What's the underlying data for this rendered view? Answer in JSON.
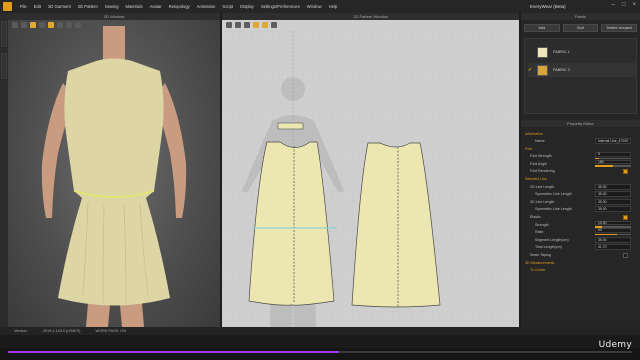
{
  "titlebar": {
    "menu": [
      "File",
      "Edit",
      "3D Garment",
      "2D Pattern",
      "Sewing",
      "Materials",
      "Avatar",
      "Retopology",
      "Animation",
      "Script",
      "Display",
      "Settings/Preferences",
      "Window",
      "Help"
    ],
    "app_title": "EveryWear (Beta)"
  },
  "panels": {
    "win3d_title": "3D Window",
    "win2d_title": "2D Pattern Window",
    "fabric_title": "Fabric",
    "property_title": "Property Editor"
  },
  "fabric": {
    "buttons": [
      "Add",
      "Sort",
      "Delete Unused"
    ],
    "items": [
      {
        "name": "FABRIC 1",
        "color": "#ece6b8",
        "checked": false
      },
      {
        "name": "FABRIC 2",
        "color": "#d9a43a",
        "checked": true
      }
    ]
  },
  "property_editor": {
    "rows": [
      {
        "label": "Information",
        "type": "section",
        "indent": 0
      },
      {
        "label": "Name",
        "value": "Internal Line_47029",
        "indent": 2
      },
      {
        "label": "Fold",
        "type": "section",
        "indent": 0
      },
      {
        "label": "Fold Strength",
        "value": "5",
        "slider": 0.1,
        "indent": 1
      },
      {
        "label": "Fold Angle",
        "value": "180",
        "slider": 0.5,
        "indent": 1
      },
      {
        "label": "Fold Rendering",
        "checkbox": true,
        "indent": 1
      },
      {
        "label": "Selected Line",
        "type": "section",
        "indent": 0
      },
      {
        "label": "2D Line Length",
        "value": "35.00",
        "indent": 1
      },
      {
        "label": "Symmetric Line Length",
        "value": "35.00",
        "indent": 2
      },
      {
        "label": "3D Line Length",
        "value": "35.00",
        "indent": 1
      },
      {
        "label": "Symmetric Line Length",
        "value": "35.00",
        "indent": 2
      },
      {
        "label": "Elastic",
        "checkbox": true,
        "indent": 1
      },
      {
        "label": "Strength",
        "value": "10.00",
        "slider": 0.2,
        "indent": 2
      },
      {
        "label": "Ratio",
        "value": "60",
        "slider": 0.6,
        "indent": 2
      },
      {
        "label": "Segment Length(cm)",
        "value": "35.00",
        "indent": 2
      },
      {
        "label": "Total Length(cm)",
        "value": "41.70",
        "indent": 2
      },
      {
        "label": "Seam Taping",
        "checkbox": false,
        "indent": 1
      },
      {
        "label": "3D Measurements",
        "type": "section",
        "indent": 0
      },
      {
        "label": "To Center",
        "type": "section",
        "indent": 1
      }
    ]
  },
  "statusbar": {
    "version_label": "Version:",
    "version": "2019.1.143.0 (r29570)",
    "memory": "WORK PASS: ON"
  },
  "video": {
    "progress": 0.53,
    "brand": "Udemy"
  }
}
